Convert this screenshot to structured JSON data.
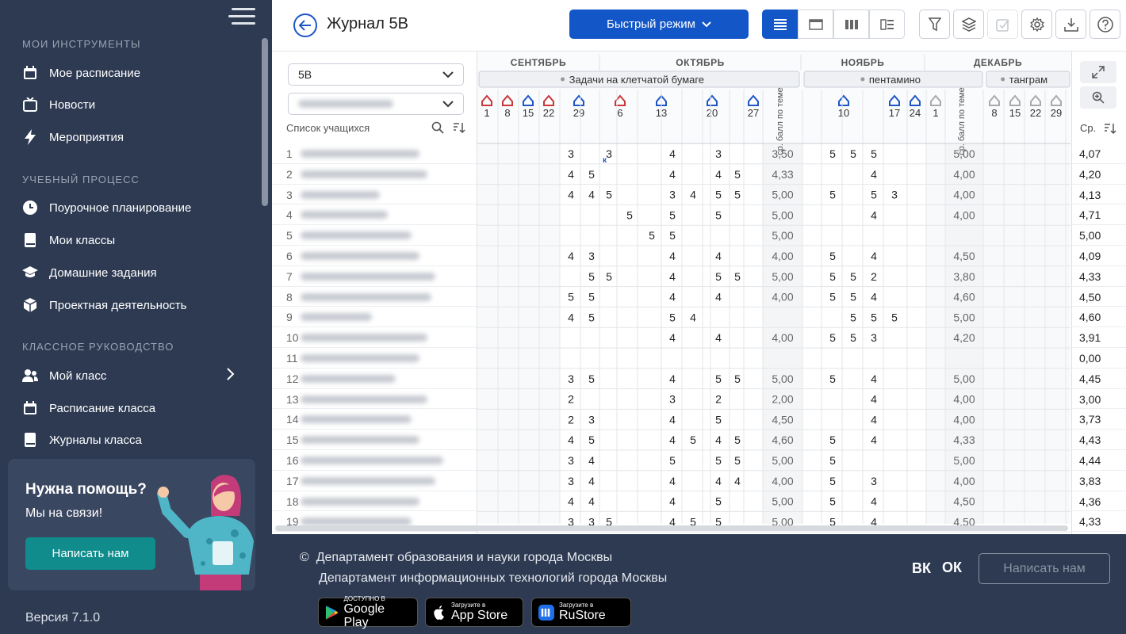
{
  "sidebar": {
    "sections": [
      {
        "title": "МОИ ИНСТРУМЕНТЫ",
        "items": [
          {
            "label": "Мое расписание",
            "icon": "calendar-icon"
          },
          {
            "label": "Новости",
            "icon": "tv-icon"
          },
          {
            "label": "Мероприятия",
            "icon": "lightning-icon"
          }
        ]
      },
      {
        "title": "УЧЕБНЫЙ ПРОЦЕСС",
        "items": [
          {
            "label": "Поурочное планирование",
            "icon": "clock-icon"
          },
          {
            "label": "Мои классы",
            "icon": "book-icon"
          },
          {
            "label": "Домашние задания",
            "icon": "graduation-cap-icon"
          },
          {
            "label": "Проектная деятельность",
            "icon": "cube-icon"
          }
        ]
      },
      {
        "title": "КЛАССНОЕ РУКОВОДСТВО",
        "items": [
          {
            "label": "Мой класс",
            "icon": "users-icon"
          },
          {
            "label": "Расписание класса",
            "icon": "calendar-icon"
          },
          {
            "label": "Журналы класса",
            "icon": "book-icon"
          }
        ]
      }
    ],
    "help": {
      "title": "Нужна помощь?",
      "subtitle": "Мы на связи!",
      "button": "Написать нам"
    },
    "version": "Версия 7.1.0"
  },
  "header": {
    "title": "Журнал 5В",
    "mode_button": "Быстрый режим",
    "view_buttons": [
      "list-view-icon",
      "single-view-icon",
      "columns-view-icon",
      "split-view-icon"
    ],
    "tools": [
      "filter-icon",
      "layers-icon",
      "check-icon",
      "gear-icon",
      "download-icon",
      "help-icon"
    ]
  },
  "journal": {
    "class_select": "5В",
    "student_list_label": "Список учащихся",
    "avg_header": "Ср.",
    "topic_avg_label": "ср. балл по теме",
    "months": [
      "СЕНТЯБРЬ",
      "ОКТЯБРЬ",
      "НОЯБРЬ",
      "ДЕКАБРЬ"
    ],
    "topics": [
      "Задачи на клетчатой бумаге",
      "пентамино",
      "танграм"
    ],
    "dates": [
      "1",
      "8",
      "15",
      "22",
      "29",
      "6",
      "13",
      "20",
      "27",
      "10",
      "17",
      "24",
      "1",
      "8",
      "15",
      "22",
      "29"
    ],
    "rows": [
      {
        "n": "1",
        "avg": "4,07",
        "ta1": "3,50",
        "ta2": "5,00",
        "c29": [
          "3",
          "",
          "к3"
        ],
        "c13": [
          "4"
        ],
        "c20": [
          "3"
        ],
        "c10": [
          "5",
          "5",
          "5"
        ]
      },
      {
        "n": "2",
        "avg": "4,20",
        "ta1": "4,33",
        "ta2": "4,00",
        "c29": [
          "4",
          "5"
        ],
        "c13": [
          "4"
        ],
        "c20": [
          "4",
          "5"
        ],
        "c10": [
          "",
          "",
          "4"
        ]
      },
      {
        "n": "3",
        "avg": "4,13",
        "ta1": "5,00",
        "ta2": "4,00",
        "c29": [
          "4",
          "4",
          "5"
        ],
        "c13": [
          "3",
          "4"
        ],
        "c20": [
          "5",
          "5"
        ],
        "c10": [
          "5",
          "",
          "5",
          "3"
        ]
      },
      {
        "n": "4",
        "avg": "4,71",
        "ta1": "5,00",
        "ta2": "4,00",
        "c29": [
          "",
          "",
          "",
          "5"
        ],
        "c13": [
          "5"
        ],
        "c20": [
          "5"
        ],
        "c10": [
          "",
          "",
          "4"
        ]
      },
      {
        "n": "5",
        "avg": "5,00",
        "ta1": "5,00",
        "ta2": "",
        "c29": [
          "",
          "",
          "",
          "",
          "5"
        ],
        "c13": [
          "5"
        ],
        "c20": [
          ""
        ],
        "c10": []
      },
      {
        "n": "6",
        "avg": "4,09",
        "ta1": "4,00",
        "ta2": "4,50",
        "c29": [
          "4",
          "3"
        ],
        "c13": [
          "4"
        ],
        "c20": [
          "4"
        ],
        "c10": [
          "5",
          "",
          "4"
        ]
      },
      {
        "n": "7",
        "avg": "4,33",
        "ta1": "5,00",
        "ta2": "3,80",
        "c29": [
          "",
          "5",
          "5"
        ],
        "c13": [
          "4"
        ],
        "c20": [
          "5",
          "5"
        ],
        "c10": [
          "5",
          "5",
          "2"
        ]
      },
      {
        "n": "8",
        "avg": "4,50",
        "ta1": "4,00",
        "ta2": "4,60",
        "c29": [
          "5",
          "5"
        ],
        "c13": [
          "4"
        ],
        "c20": [
          "4"
        ],
        "c10": [
          "5",
          "5",
          "4"
        ]
      },
      {
        "n": "9",
        "avg": "4,60",
        "ta1": "",
        "ta2": "5,00",
        "c29": [
          "4",
          "5"
        ],
        "c13": [
          "5",
          "4"
        ],
        "c20": [
          ""
        ],
        "c10": [
          "",
          "5",
          "5",
          "5"
        ]
      },
      {
        "n": "10",
        "avg": "3,91",
        "ta1": "4,00",
        "ta2": "4,20",
        "c29": [
          ""
        ],
        "c13": [
          "4"
        ],
        "c20": [
          "4"
        ],
        "c10": [
          "5",
          "5",
          "3"
        ]
      },
      {
        "n": "11",
        "avg": "0,00",
        "ta1": "",
        "ta2": "",
        "c29": [],
        "c13": [],
        "c20": [],
        "c10": []
      },
      {
        "n": "12",
        "avg": "4,45",
        "ta1": "5,00",
        "ta2": "5,00",
        "c29": [
          "3",
          "5"
        ],
        "c13": [
          "4"
        ],
        "c20": [
          "5",
          "5"
        ],
        "c10": [
          "5",
          "",
          "4"
        ]
      },
      {
        "n": "13",
        "avg": "3,00",
        "ta1": "2,00",
        "ta2": "4,00",
        "c29": [
          "2"
        ],
        "c13": [
          "3"
        ],
        "c20": [
          "2"
        ],
        "c10": [
          "",
          "",
          "4"
        ]
      },
      {
        "n": "14",
        "avg": "3,73",
        "ta1": "4,50",
        "ta2": "4,00",
        "c29": [
          "2",
          "3"
        ],
        "c13": [
          "4"
        ],
        "c20": [
          "5"
        ],
        "c10": [
          "",
          "",
          "4"
        ]
      },
      {
        "n": "15",
        "avg": "4,43",
        "ta1": "4,60",
        "ta2": "4,33",
        "c29": [
          "4",
          "5"
        ],
        "c13": [
          "4",
          "5"
        ],
        "c20": [
          "4",
          "5"
        ],
        "c10": [
          "5",
          "",
          "4"
        ]
      },
      {
        "n": "16",
        "avg": "4,44",
        "ta1": "5,00",
        "ta2": "5,00",
        "c29": [
          "3",
          "4"
        ],
        "c13": [
          "5"
        ],
        "c20": [
          "5",
          "5"
        ],
        "c10": [
          "5"
        ]
      },
      {
        "n": "17",
        "avg": "3,83",
        "ta1": "4,00",
        "ta2": "4,00",
        "c29": [
          "3",
          "4"
        ],
        "c13": [
          "4"
        ],
        "c20": [
          "4",
          "4"
        ],
        "c10": [
          "5",
          "",
          "3"
        ]
      },
      {
        "n": "18",
        "avg": "4,36",
        "ta1": "5,00",
        "ta2": "4,50",
        "c29": [
          "4",
          "4"
        ],
        "c13": [
          "4"
        ],
        "c20": [
          "5"
        ],
        "c10": [
          "5",
          "",
          "4"
        ]
      },
      {
        "n": "19",
        "avg": "4,33",
        "ta1": "5,00",
        "ta2": "4,50",
        "c29": [
          "3",
          "3",
          "5"
        ],
        "c13": [
          "4",
          "5"
        ],
        "c20": [
          "5"
        ],
        "c10": [
          "5",
          "",
          "4"
        ]
      }
    ]
  },
  "footer": {
    "copy1": "Департамент образования и науки города Москвы",
    "copy2": "Департамент информационных технологий города Москвы",
    "copyright_sign": "©",
    "write_button": "Написать нам",
    "social": [
      "ВК",
      "ОК"
    ],
    "stores": [
      {
        "small": "ДОСТУПНО В",
        "big": "Google Play"
      },
      {
        "small": "Загрузите в",
        "big": "App Store"
      },
      {
        "small": "Загрузите в",
        "big": "RuStore"
      }
    ]
  }
}
